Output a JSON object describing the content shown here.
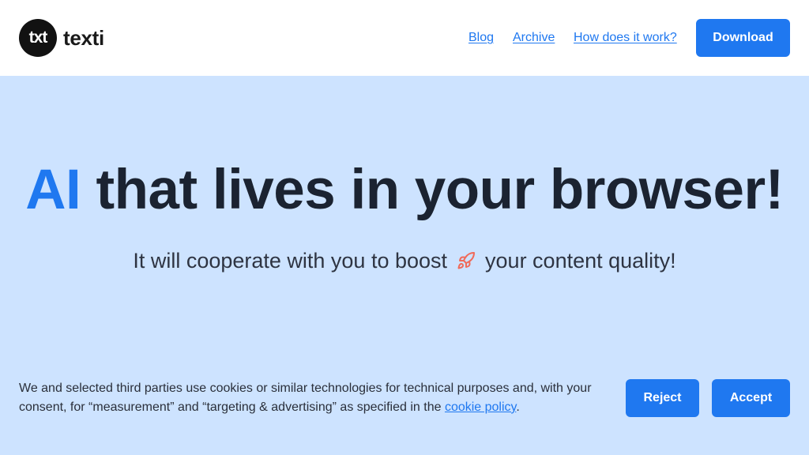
{
  "brand": {
    "logo_mark": "txt",
    "name": "texti"
  },
  "nav": {
    "blog": "Blog",
    "archive": "Archive",
    "how_it_works": "How does it work?",
    "download": "Download"
  },
  "hero": {
    "title_accent": "AI",
    "title_rest": " that lives in your browser!",
    "subtitle_before": "It will cooperate with you to boost",
    "subtitle_after": "your content quality!",
    "subtitle_icon": "rocket-icon"
  },
  "cookie_banner": {
    "text_before": "We and selected third parties use cookies or similar technologies for technical purposes and, with your consent, for “measurement” and “targeting & advertising” as specified in the ",
    "link": "cookie policy",
    "text_after": ".",
    "reject": "Reject",
    "accept": "Accept"
  },
  "colors": {
    "accent": "#1f78f0",
    "hero_background": "#cde3ff",
    "heading": "#1b2331",
    "logo_background": "#121212",
    "rocket": "#f06a5a"
  }
}
